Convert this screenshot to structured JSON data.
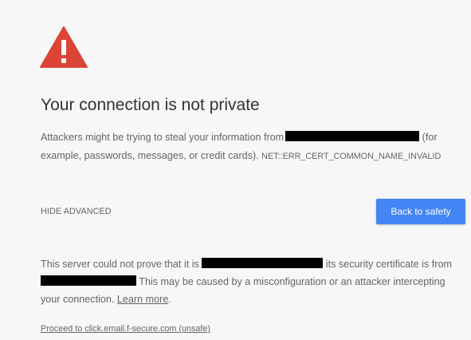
{
  "warning": {
    "icon": "warning-triangle-icon",
    "icon_color": "#db4437"
  },
  "title": "Your connection is not private",
  "intro": {
    "text_before": "Attackers might be trying to steal your information from",
    "text_after": " (for example, passwords, messages, or credit cards).",
    "error_code": "NET::ERR_CERT_COMMON_NAME_INVALID"
  },
  "advanced": {
    "hide_label": "HIDE ADVANCED"
  },
  "back_button": {
    "label": "Back to safety",
    "color": "#4285f4"
  },
  "details": {
    "part1": "This server could not prove that it is ",
    "part2": " its security certificate is from ",
    "part3": " This may be caused by a misconfiguration or an attacker intercepting your connection.",
    "learn_more": "Learn more",
    "period": "."
  },
  "proceed": {
    "label": "Proceed to click.email.f-secure.com (unsafe)"
  }
}
